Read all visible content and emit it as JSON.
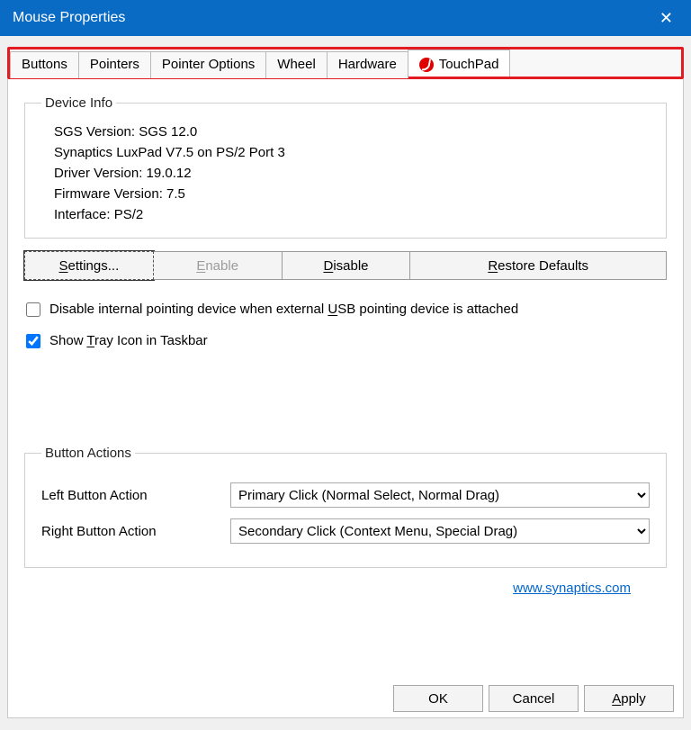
{
  "window": {
    "title": "Mouse Properties"
  },
  "tabs": {
    "buttons": "Buttons",
    "pointers": "Pointers",
    "pointerOptions": "Pointer Options",
    "wheel": "Wheel",
    "hardware": "Hardware",
    "touchpad": "TouchPad"
  },
  "deviceInfo": {
    "legend": "Device Info",
    "line1": "SGS Version: SGS 12.0",
    "line2": "Synaptics LuxPad V7.5 on PS/2 Port 3",
    "line3": "Driver Version: 19.0.12",
    "line4": "Firmware Version: 7.5",
    "line5": "Interface: PS/2"
  },
  "actions": {
    "settings": "Settings...",
    "enable": "Enable",
    "disable": "Disable",
    "restore": "Restore Defaults"
  },
  "checkboxes": {
    "disableInternal_pre": "Disable internal pointing device when external ",
    "disableInternal_u": "U",
    "disableInternal_post": "SB pointing device is attached",
    "showTray_pre": "Show ",
    "showTray_u": "T",
    "showTray_post": "ray Icon in Taskbar"
  },
  "buttonActions": {
    "legend": "Button Actions",
    "leftLabel": "Left Button Action",
    "leftValue": "Primary Click (Normal Select, Normal Drag)",
    "rightLabel": "Right Button Action",
    "rightValue": "Secondary Click (Context Menu, Special Drag)"
  },
  "link": {
    "text": "www.synaptics.com"
  },
  "dlgBtns": {
    "ok": "OK",
    "cancel": "Cancel",
    "apply": "Apply"
  },
  "underline": {
    "s": "S",
    "e": "E",
    "d": "D",
    "r": "R",
    "a": "A"
  }
}
